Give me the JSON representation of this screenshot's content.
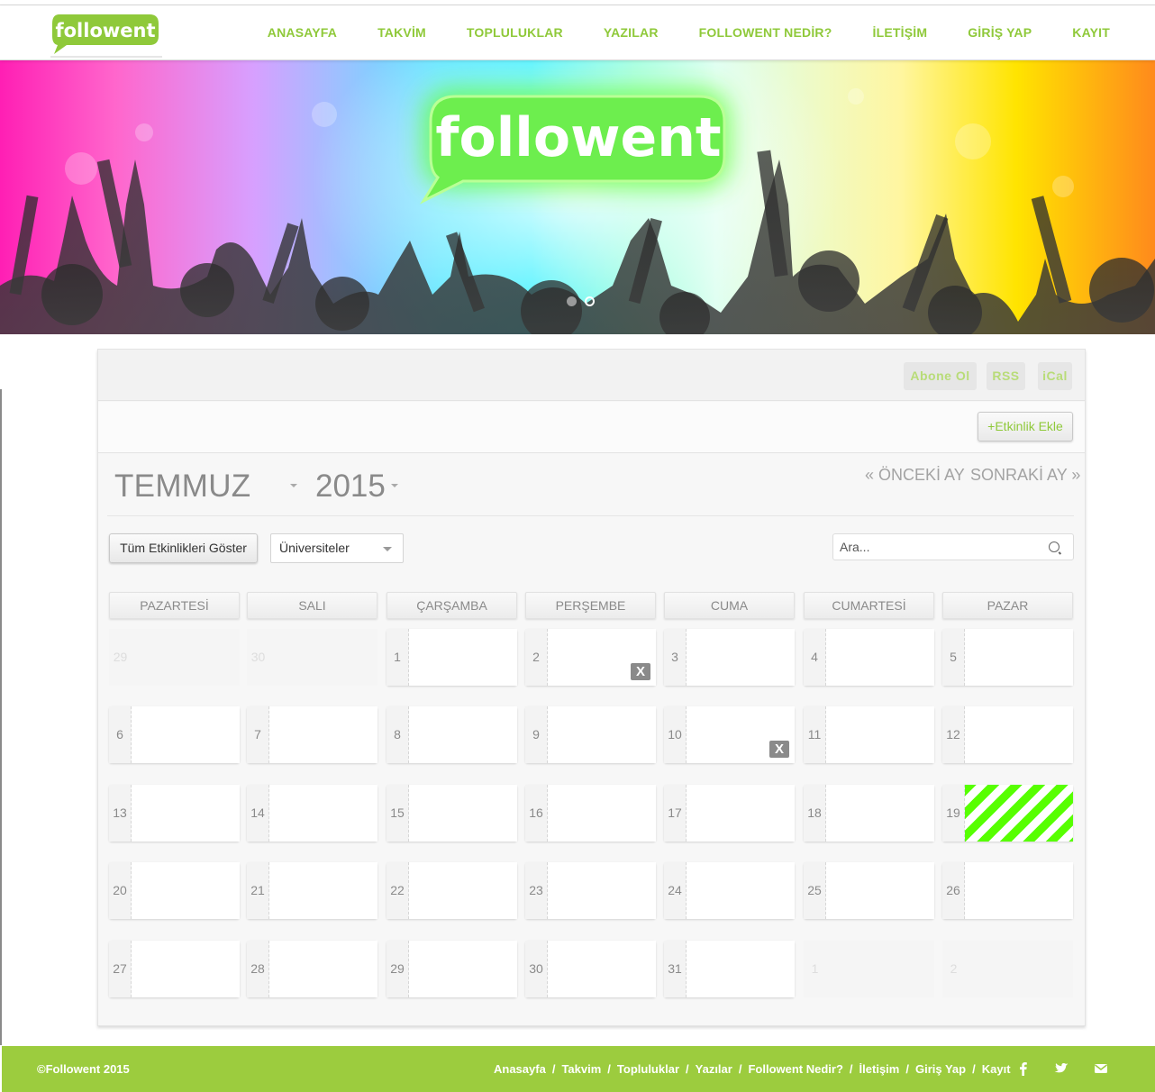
{
  "brand": {
    "logo_text": "followent",
    "hero_logo_text": "followent",
    "accent_color": "#8fc93a",
    "today_stripe_color": "#57ff00"
  },
  "nav": {
    "items": [
      {
        "label": "ANASAYFA"
      },
      {
        "label": "TAKVİM"
      },
      {
        "label": "TOPLULUKLAR"
      },
      {
        "label": "YAZILAR"
      },
      {
        "label": "FOLLOWENT NEDİR?"
      },
      {
        "label": "İLETİŞİM"
      },
      {
        "label": "GİRİŞ YAP"
      },
      {
        "label": "KAYIT"
      }
    ]
  },
  "hero": {
    "slide_count": 2,
    "active_slide": 2
  },
  "calendar": {
    "subscribe": {
      "abone": "Abone Ol",
      "rss": "RSS",
      "ical": "iCal"
    },
    "add_event_label": "+Etkinlik Ekle",
    "month": "TEMMUZ",
    "year": "2015",
    "prev_label": "« ÖNCEKİ AY",
    "next_label": "SONRAKİ AY »",
    "show_all_label": "Tüm Etkinlikleri Göster",
    "filter_selected": "Üniversiteler",
    "search_placeholder": "Ara...",
    "weekdays": [
      "PAZARTESİ",
      "SALI",
      "ÇARŞAMBA",
      "PERŞEMBE",
      "CUMA",
      "CUMARTESİ",
      "PAZAR"
    ],
    "delete_mark": "X",
    "weeks": [
      [
        {
          "d": "29",
          "out": true
        },
        {
          "d": "30",
          "out": true
        },
        {
          "d": "1"
        },
        {
          "d": "2",
          "x": true
        },
        {
          "d": "3"
        },
        {
          "d": "4"
        },
        {
          "d": "5"
        }
      ],
      [
        {
          "d": "6"
        },
        {
          "d": "7"
        },
        {
          "d": "8"
        },
        {
          "d": "9"
        },
        {
          "d": "10",
          "x": true
        },
        {
          "d": "11"
        },
        {
          "d": "12"
        }
      ],
      [
        {
          "d": "13"
        },
        {
          "d": "14"
        },
        {
          "d": "15"
        },
        {
          "d": "16"
        },
        {
          "d": "17"
        },
        {
          "d": "18"
        },
        {
          "d": "19",
          "today": true
        }
      ],
      [
        {
          "d": "20"
        },
        {
          "d": "21"
        },
        {
          "d": "22"
        },
        {
          "d": "23"
        },
        {
          "d": "24"
        },
        {
          "d": "25"
        },
        {
          "d": "26"
        }
      ],
      [
        {
          "d": "27"
        },
        {
          "d": "28"
        },
        {
          "d": "29"
        },
        {
          "d": "30"
        },
        {
          "d": "31"
        },
        {
          "d": "1",
          "out": true
        },
        {
          "d": "2",
          "out": true
        }
      ]
    ]
  },
  "footer": {
    "copyright": "©Followent 2015",
    "links": [
      "Anasayfa",
      "Takvim",
      "Topluluklar",
      "Yazılar",
      "Followent Nedir?",
      "İletişim",
      "Giriş Yap",
      "Kayıt"
    ],
    "separator": "/",
    "social": [
      "facebook-icon",
      "twitter-icon",
      "mail-icon"
    ]
  }
}
